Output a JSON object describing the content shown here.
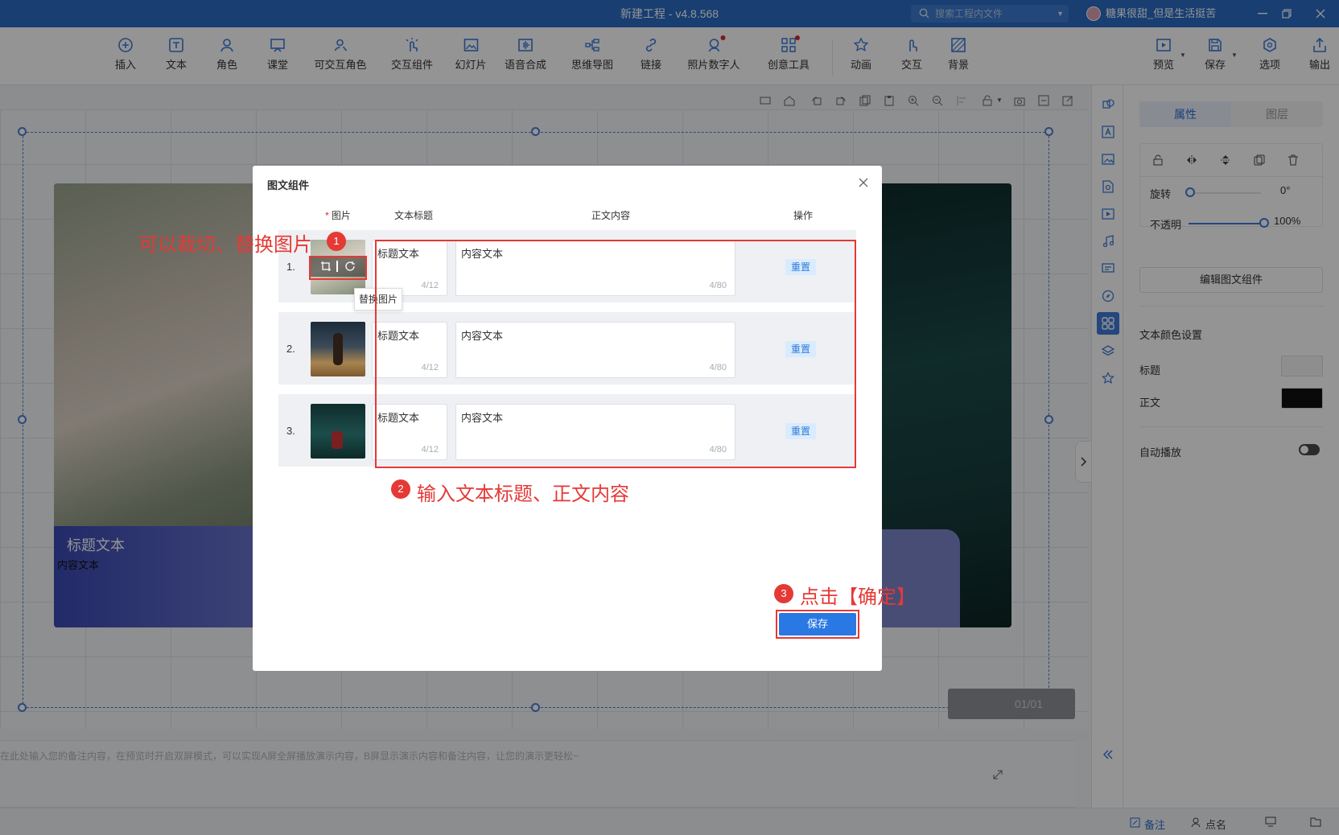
{
  "window": {
    "title": "新建工程 - v4.8.568",
    "search_placeholder": "搜索工程内文件",
    "user_name": "糖果很甜_但是生活挺苦"
  },
  "toolbar": {
    "items": [
      "插入",
      "文本",
      "角色",
      "课堂",
      "可交互角色",
      "交互组件",
      "幻灯片",
      "语音合成",
      "思维导图",
      "链接",
      "照片数字人",
      "创意工具",
      "动画",
      "交互",
      "背景"
    ],
    "right_items": [
      "预览",
      "保存",
      "选项",
      "输出"
    ]
  },
  "canvas": {
    "caption_title": "标题文本",
    "caption_text": "内容文本",
    "pager": "01/01",
    "notes_placeholder": "在此处输入您的备注内容，在预览时开启双屏模式，可以实现A屏全屏播放演示内容，B屏显示演示内容和备注内容，让您的演示更轻松~"
  },
  "props": {
    "tab_properties": "属性",
    "tab_layers": "图层",
    "rotate_label": "旋转",
    "rotate_value": "0°",
    "opacity_label": "不透明",
    "opacity_value": "100%",
    "opacity_level": 1.0,
    "edit_button": "编辑图文组件",
    "text_color_heading": "文本颜色设置",
    "title_color_label": "标题",
    "title_color": "#f5f5f5",
    "body_color_label": "正文",
    "body_color": "#111111",
    "autoplay_label": "自动播放"
  },
  "statusbar": {
    "notes": "备注",
    "rollcall": "点名"
  },
  "modal": {
    "title": "图文组件",
    "headers": {
      "image": "图片",
      "text_title": "文本标题",
      "body": "正文内容",
      "action": "操作"
    },
    "rows": [
      {
        "num": "1.",
        "title": "标题文本",
        "title_count": "4/12",
        "body": "内容文本",
        "body_count": "4/80",
        "reset": "重置"
      },
      {
        "num": "2.",
        "title": "标题文本",
        "title_count": "4/12",
        "body": "内容文本",
        "body_count": "4/80",
        "reset": "重置"
      },
      {
        "num": "3.",
        "title": "标题文本",
        "title_count": "4/12",
        "body": "内容文本",
        "body_count": "4/80",
        "reset": "重置"
      }
    ],
    "tooltip": "替换图片",
    "save": "保存"
  },
  "annotations": {
    "note1": "可以裁切、替换图片",
    "note2": "输入文本标题、正文内容",
    "note3": "点击【确定】",
    "badge1": "1",
    "badge2": "2",
    "badge3": "3"
  },
  "colors": {
    "accent": "#2a78e4",
    "annotation_red": "#e53935",
    "titlebar": "#2a6bc4"
  }
}
